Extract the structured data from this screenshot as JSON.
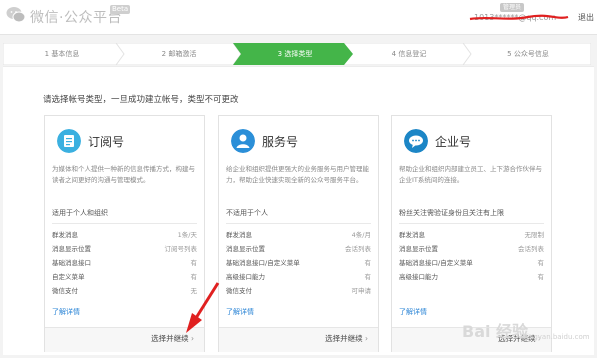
{
  "header": {
    "brand": "微信·公众平台",
    "beta": "Beta",
    "account_badge": "管理员",
    "account": "1013******@qq.com",
    "logout": "退出"
  },
  "steps": [
    {
      "label": "1 基本信息",
      "active": false
    },
    {
      "label": "2 邮箱激活",
      "active": false
    },
    {
      "label": "3 选择类型",
      "active": true
    },
    {
      "label": "4 信息登记",
      "active": false
    },
    {
      "label": "5 公众号信息",
      "active": false
    }
  ],
  "colors": {
    "step_active": "#44b549",
    "link": "#2a84d6",
    "annotation": "#e02020"
  },
  "prompt": "请选择帐号类型，一旦成功建立帐号，类型不可更改",
  "cards": [
    {
      "title": "订阅号",
      "icon": "doc-icon",
      "icon_color": "#3bb0e0",
      "desc": "为媒体和个人提供一种新的信息传播方式，构建与读者之间更好的沟通与管理模式。",
      "audience": "适用于个人和组织",
      "features": [
        {
          "k": "群发消息",
          "v": "1条/天"
        },
        {
          "k": "消息显示位置",
          "v": "订阅号列表"
        },
        {
          "k": "基础消息接口",
          "v": "有"
        },
        {
          "k": "自定义菜单",
          "v": "有"
        },
        {
          "k": "微信支付",
          "v": "无"
        }
      ],
      "more": "了解详情",
      "select": "选择并继续"
    },
    {
      "title": "服务号",
      "icon": "person-icon",
      "icon_color": "#2b8fd8",
      "desc": "给企业和组织提供更强大的业务服务与用户管理能力，帮助企业快速实现全新的公众号服务平台。",
      "audience": "不适用于个人",
      "features": [
        {
          "k": "群发消息",
          "v": "4条/月"
        },
        {
          "k": "消息显示位置",
          "v": "会话列表"
        },
        {
          "k": "基础消息接口/自定义菜单",
          "v": "有"
        },
        {
          "k": "高级接口能力",
          "v": "有"
        },
        {
          "k": "微信支付",
          "v": "可申请"
        }
      ],
      "more": "了解详情",
      "select": "选择并继续"
    },
    {
      "title": "企业号",
      "icon": "chat-icon",
      "icon_color": "#1c86c6",
      "desc": "帮助企业和组织内部建立员工、上下游合作伙伴与企业IT系统间的连接。",
      "audience": "粉丝关注需验证身份且关注有上限",
      "features": [
        {
          "k": "群发消息",
          "v": "无限制"
        },
        {
          "k": "消息显示位置",
          "v": "会话列表"
        },
        {
          "k": "基础消息接口/自定义菜单",
          "v": "有"
        },
        {
          "k": "高级接口能力",
          "v": "有"
        }
      ],
      "more": "了解详情",
      "select": "选择并继续"
    }
  ],
  "watermark": "Bai 经验",
  "watermark_sub": "jingyan.baidu.com"
}
